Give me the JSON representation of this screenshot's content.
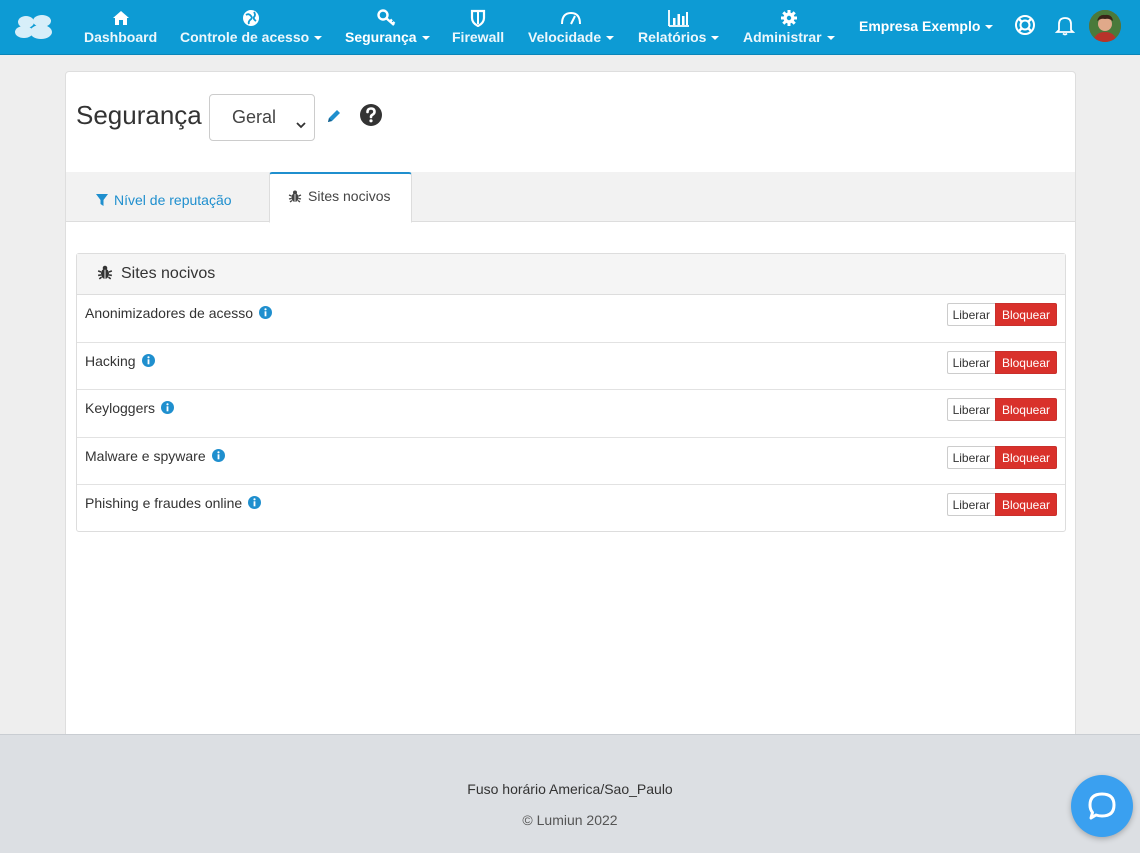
{
  "colors": {
    "navbar": "#0d9bd4",
    "accent": "#1f8fce",
    "danger": "#d9312b",
    "footer": "#dcdfe3"
  },
  "navbar": {
    "brand_icon": "cloud-logo-icon",
    "items": [
      {
        "label": "Dashboard",
        "icon": "home-icon",
        "dropdown": false
      },
      {
        "label": "Controle de acesso",
        "icon": "globe-icon",
        "dropdown": true
      },
      {
        "label": "Segurança",
        "icon": "key-icon",
        "dropdown": true,
        "active": true
      },
      {
        "label": "Firewall",
        "icon": "shield-icon",
        "dropdown": false
      },
      {
        "label": "Velocidade",
        "icon": "speedometer-icon",
        "dropdown": true
      },
      {
        "label": "Relatórios",
        "icon": "bar-chart-icon",
        "dropdown": true
      },
      {
        "label": "Administrar",
        "icon": "gear-icon",
        "dropdown": true
      }
    ],
    "company": "Empresa Exemplo",
    "right_icons": [
      "lifebuoy-icon",
      "bell-icon",
      "avatar"
    ]
  },
  "page": {
    "title": "Segurança",
    "profile_select": "Geral",
    "tabs": [
      {
        "label": "Nível de reputação",
        "icon": "filter-icon",
        "active": false
      },
      {
        "label": "Sites nocivos",
        "icon": "bug-icon",
        "active": true
      }
    ]
  },
  "section": {
    "title": "Sites nocivos",
    "rows": [
      {
        "label": "Anonimizadores de acesso",
        "allow": "Liberar",
        "block": "Bloquear"
      },
      {
        "label": "Hacking",
        "allow": "Liberar",
        "block": "Bloquear"
      },
      {
        "label": "Keyloggers",
        "allow": "Liberar",
        "block": "Bloquear"
      },
      {
        "label": "Malware e spyware",
        "allow": "Liberar",
        "block": "Bloquear"
      },
      {
        "label": "Phishing e fraudes online",
        "allow": "Liberar",
        "block": "Bloquear"
      }
    ]
  },
  "footer": {
    "timezone": "Fuso horário America/Sao_Paulo",
    "copyright": "© Lumiun 2022"
  }
}
